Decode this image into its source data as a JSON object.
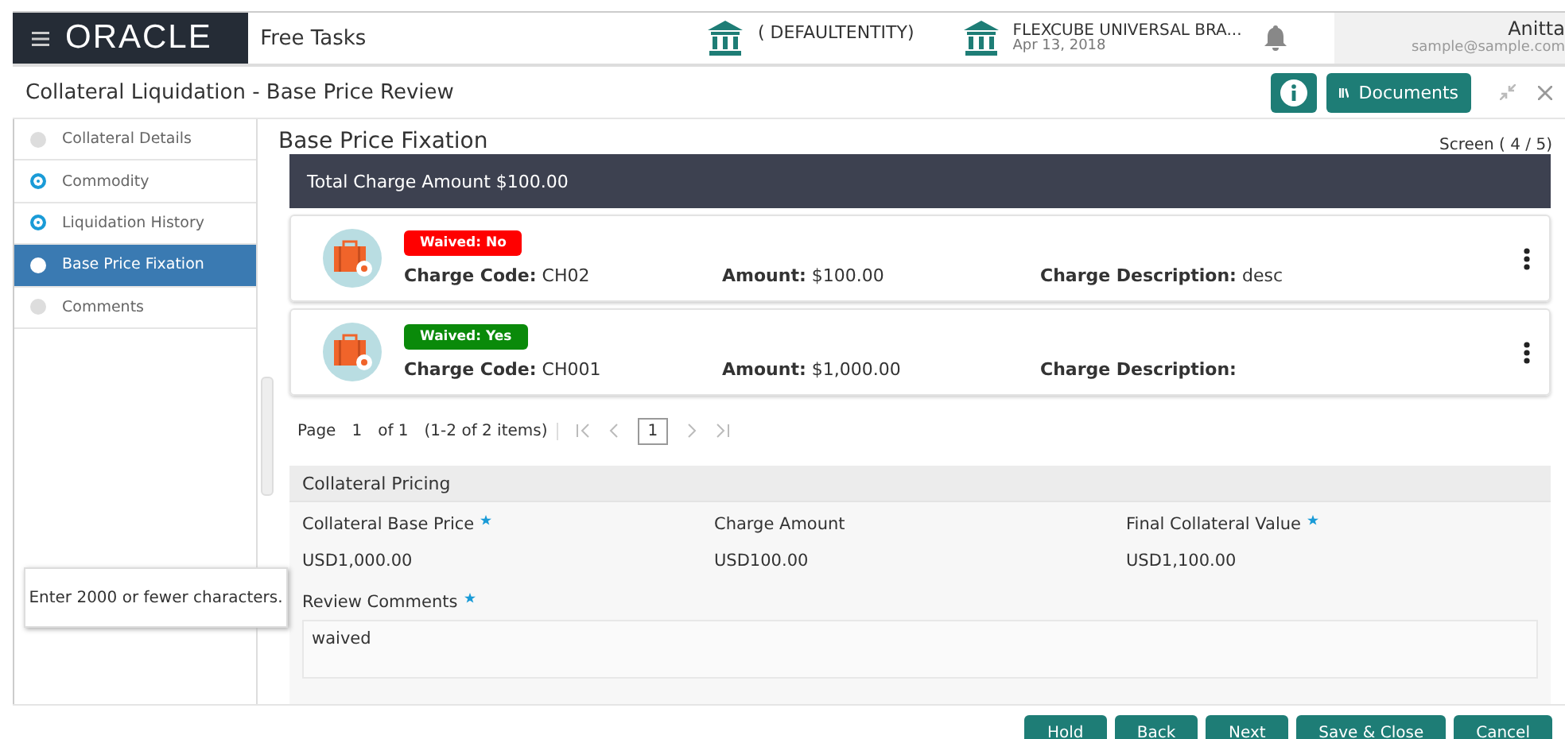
{
  "header": {
    "logo": "ORACLE",
    "app_title": "Free Tasks",
    "entity": "( DEFAULTENTITY)",
    "branch": "FLEXCUBE UNIVERSAL BRA...",
    "date": "Apr 13, 2018",
    "user_name": "Anitta",
    "user_email": "sample@sample.com"
  },
  "title_bar": {
    "title": "Collateral Liquidation - Base Price Review",
    "documents_label": "Documents"
  },
  "steps": [
    {
      "label": "Collateral Details",
      "visited": false,
      "selected": false
    },
    {
      "label": "Commodity",
      "visited": true,
      "selected": false
    },
    {
      "label": "Liquidation History",
      "visited": true,
      "selected": false
    },
    {
      "label": "Base Price Fixation",
      "visited": false,
      "selected": true
    },
    {
      "label": "Comments",
      "visited": false,
      "selected": false
    }
  ],
  "section_title": "Base Price Fixation",
  "screen_counter": "Screen ( 4 / 5)",
  "total_banner": "Total Charge Amount $100.00",
  "charges": [
    {
      "waived": false,
      "waived_label": "Waived: No",
      "code_label": "Charge Code:",
      "code": "CH02",
      "amount_label": "Amount:",
      "amount": "$100.00",
      "description_label": "Charge Description:",
      "description": "desc"
    },
    {
      "waived": true,
      "waived_label": "Waived: Yes",
      "code_label": "Charge Code:",
      "code": "CH001",
      "amount_label": "Amount:",
      "amount": "$1,000.00",
      "description_label": "Charge Description:"
    }
  ],
  "pagination": {
    "page_label": "Page",
    "page": "1",
    "of_label": "of 1",
    "range": "(1-2 of 2 items)",
    "current": "1"
  },
  "pricing": {
    "title": "Collateral Pricing",
    "fields": [
      {
        "label": "Collateral Base Price",
        "required": true,
        "value": "USD1,000.00"
      },
      {
        "label": "Charge Amount",
        "required": false,
        "value": "USD100.00"
      },
      {
        "label": "Final Collateral Value",
        "required": true,
        "value": "USD1,100.00"
      }
    ],
    "comments_label": "Review Comments",
    "comments_required": true,
    "comments_value": "waived"
  },
  "tooltip": "Enter 2000 or fewer characters.",
  "buttons": [
    "Hold",
    "Back",
    "Next",
    "Save & Close",
    "Cancel"
  ]
}
